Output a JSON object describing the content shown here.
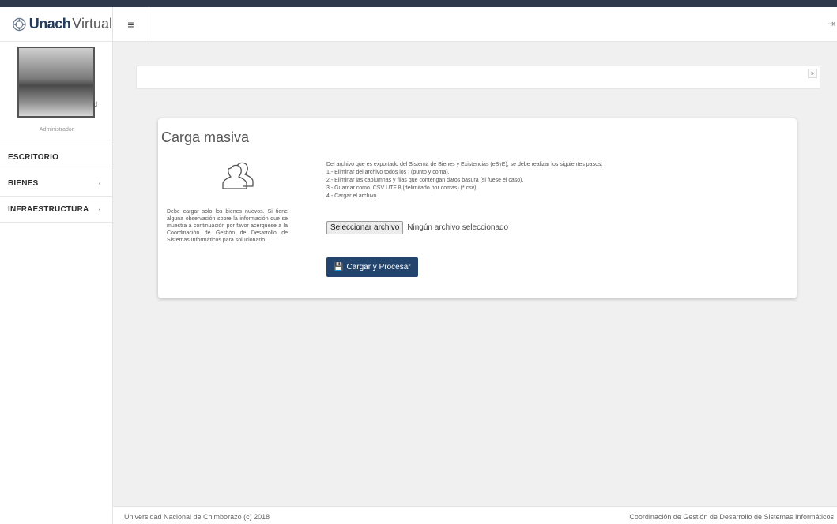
{
  "brand": {
    "name_bold": "Unach",
    "name_light": "Virtual"
  },
  "profile": {
    "name_fragment": "d",
    "role": "Administrador"
  },
  "nav": {
    "items": [
      {
        "label": "ESCRITORIO",
        "chevron": ""
      },
      {
        "label": "BIENES",
        "chevron": "‹"
      },
      {
        "label": "INFRAESTRUCTURA",
        "chevron": "‹"
      }
    ]
  },
  "topbar": {
    "menu_icon": "≡",
    "logout_icon": "⇥"
  },
  "breadcrumb": {
    "expand_icon": "»"
  },
  "card": {
    "title": "Carga masiva",
    "note": "Debe cargar solo los bienes nuevos. Si tiene alguna observación sobre la información que se muestra a continuación por favor acérquese a la Coordinación de Gestión de Desarrollo de Sistemas Informáticos para solucionarlo.",
    "instructions": [
      "Del archivo que es exportado del Sistema de Bienes y Existencias (eByE), se debe realizar los siguientes pasos:",
      "1.- Eliminar del archivo todos los ; (punto y coma).",
      "2.- Eliminar las caolumnas y filas que contengan datos basura (si fuese el caso).",
      "3.- Guardar como. CSV UTF 8 (delimitado por comas) (*.csv).",
      "4.- Cargar el archivo."
    ],
    "file_button": "Seleccionar archivo",
    "file_status": "Ningún archivo seleccionado",
    "submit_label": "Cargar y Procesar"
  },
  "footer": {
    "left": "Universidad Nacional de Chimborazo (c) 2018",
    "right": "Coordinación de Gestión de Desarrollo de Sistemas Informáticos"
  },
  "colors": {
    "primary": "#23456d",
    "topstrip": "#2e3a4b",
    "background": "#f0f0f0"
  }
}
